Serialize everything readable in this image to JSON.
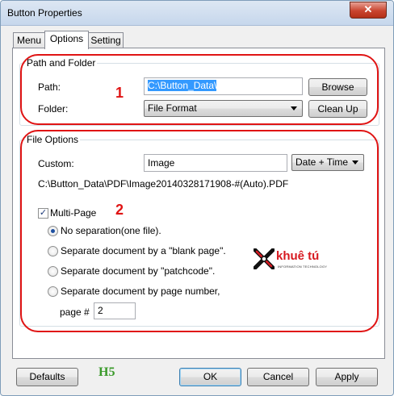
{
  "window": {
    "title": "Button Properties",
    "close_glyph": "✕"
  },
  "tabs": [
    {
      "label": "Menu",
      "active": false
    },
    {
      "label": "Options",
      "active": true
    },
    {
      "label": "Setting",
      "active": false
    }
  ],
  "path_folder": {
    "group_label": "Path and Folder",
    "path_label": "Path:",
    "path_value": "C:\\Button_Data\\",
    "browse_label": "Browse",
    "folder_label": "Folder:",
    "folder_value": "File Format",
    "cleanup_label": "Clean Up"
  },
  "file_options": {
    "group_label": "File Options",
    "custom_label": "Custom:",
    "custom_value": "Image",
    "datetime_value": "Date + Time",
    "preview_path": "C:\\Button_Data\\PDF\\Image20140328171908-#(Auto).PDF",
    "multipage_label": "Multi-Page",
    "multipage_checked": true,
    "options": [
      {
        "label": "No separation(one file).",
        "checked": true
      },
      {
        "label": "Separate document by a \"blank page\".",
        "checked": false
      },
      {
        "label": "Separate document by \"patchcode\".",
        "checked": false
      },
      {
        "label": "Separate document by page number,",
        "checked": false
      }
    ],
    "page_label": "page #",
    "page_value": "2"
  },
  "annotations": {
    "one": "1",
    "two": "2",
    "h5": "H5"
  },
  "logo": {
    "text": "khuê tú",
    "tagline": "INFORMATION TECHNOLOGY"
  },
  "footer": {
    "defaults_label": "Defaults",
    "ok_label": "OK",
    "cancel_label": "Cancel",
    "apply_label": "Apply"
  },
  "colors": {
    "annotation_red": "#e01414",
    "h5_green": "#3a9a2a"
  }
}
